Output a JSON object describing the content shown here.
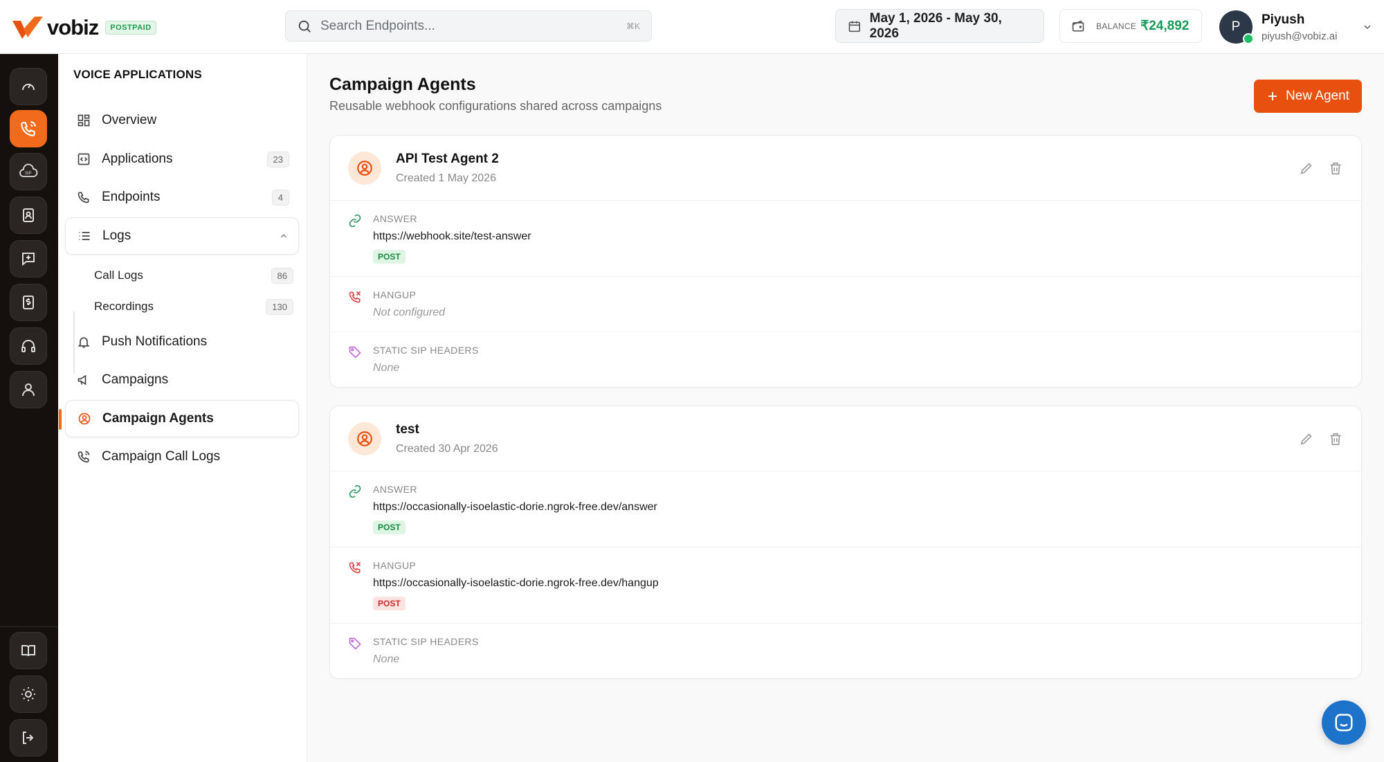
{
  "brand": {
    "name": "vobiz",
    "plan": "POSTPAID"
  },
  "search": {
    "placeholder": "Search Endpoints...",
    "shortcut": "⌘K"
  },
  "date_range": "May 1, 2026 - May 30, 2026",
  "balance": {
    "label": "BALANCE",
    "value": "₹24,892"
  },
  "user": {
    "initial": "P",
    "name": "Piyush",
    "email": "piyush@vobiz.ai"
  },
  "rail": {
    "top": [
      "speedometer-icon",
      "phone-call-icon",
      "sip-cloud-icon",
      "contact-card-icon",
      "message-plus-icon",
      "billing-icon",
      "headset-icon",
      "user-icon"
    ],
    "bottom": [
      "book-icon",
      "sun-icon",
      "logout-icon"
    ],
    "active": "phone-call-icon"
  },
  "sidebar": {
    "section_title": "VOICE APPLICATIONS",
    "items": [
      {
        "label": "Overview"
      },
      {
        "label": "Applications",
        "count": "23"
      },
      {
        "label": "Endpoints",
        "count": "4"
      },
      {
        "label": "Logs"
      },
      {
        "label": "Push Notifications"
      },
      {
        "label": "Campaigns"
      },
      {
        "label": "Campaign Agents"
      },
      {
        "label": "Campaign Call Logs"
      }
    ],
    "log_children": [
      {
        "label": "Call Logs",
        "count": "86"
      },
      {
        "label": "Recordings",
        "count": "130"
      }
    ]
  },
  "page": {
    "title": "Campaign Agents",
    "subtitle": "Reusable webhook configurations shared across campaigns",
    "new_button": "New Agent"
  },
  "agents": [
    {
      "name": "API Test Agent 2",
      "created": "Created 1 May 2026",
      "answer_label": "ANSWER",
      "answer_url": "https://webhook.site/test-answer",
      "answer_method": "POST",
      "hangup_label": "HANGUP",
      "hangup_value": "Not configured",
      "headers_label": "STATIC SIP HEADERS",
      "headers_value": "None"
    },
    {
      "name": "test",
      "created": "Created 30 Apr 2026",
      "answer_label": "ANSWER",
      "answer_url": "https://occasionally-isoelastic-dorie.ngrok-free.dev/answer",
      "answer_method": "POST",
      "hangup_label": "HANGUP",
      "hangup_url": "https://occasionally-isoelastic-dorie.ngrok-free.dev/hangup",
      "hangup_method": "POST",
      "headers_label": "STATIC SIP HEADERS",
      "headers_value": "None"
    }
  ],
  "colors": {
    "brand": "#f26a1b",
    "primary_button": "#e8500f",
    "rail_bg": "#15100e",
    "balance": "#169a5a"
  }
}
